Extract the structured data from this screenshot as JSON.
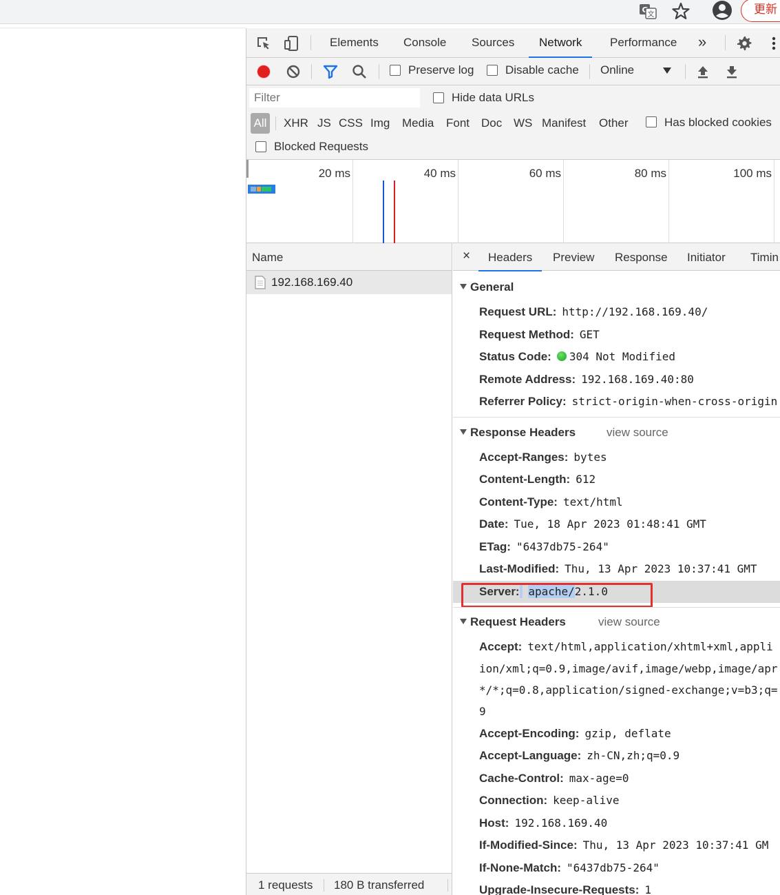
{
  "browser": {
    "update_label": "更新",
    "icons": [
      "translate-icon",
      "star-icon",
      "profile-icon"
    ]
  },
  "devtools": {
    "main_tabs": [
      {
        "label": "Elements",
        "active": false
      },
      {
        "label": "Console",
        "active": false
      },
      {
        "label": "Sources",
        "active": false
      },
      {
        "label": "Network",
        "active": true
      },
      {
        "label": "Performance",
        "active": false
      }
    ],
    "more_tabs": "»",
    "toolbar": {
      "preserve_log": "Preserve log",
      "disable_cache": "Disable cache",
      "throttle": "Online"
    },
    "filter": {
      "placeholder": "Filter",
      "hide_data_urls": "Hide data URLs",
      "types": [
        "All",
        "XHR",
        "JS",
        "CSS",
        "Img",
        "Media",
        "Font",
        "Doc",
        "WS",
        "Manifest",
        "Other"
      ],
      "has_blocked_cookies": "Has blocked cookies",
      "blocked_requests": "Blocked Requests"
    },
    "overview": {
      "ticks": [
        "20 ms",
        "40 ms",
        "60 ms",
        "80 ms",
        "100 ms"
      ]
    },
    "requests": {
      "name_header": "Name",
      "rows": [
        "192.168.169.40"
      ],
      "summary": {
        "requests": "1 requests",
        "transferred": "180 B transferred"
      }
    },
    "detail": {
      "close": "×",
      "tabs": [
        "Headers",
        "Preview",
        "Response",
        "Initiator",
        "Timin"
      ],
      "general": {
        "title": "General",
        "request_url_k": "Request URL:",
        "request_url_v": "http://192.168.169.40/",
        "request_method_k": "Request Method:",
        "request_method_v": "GET",
        "status_code_k": "Status Code:",
        "status_code_v": "304 Not Modified",
        "remote_address_k": "Remote Address:",
        "remote_address_v": "192.168.169.40:80",
        "referrer_policy_k": "Referrer Policy:",
        "referrer_policy_v": "strict-origin-when-cross-origin"
      },
      "response_headers": {
        "title": "Response Headers",
        "view_source": "view source",
        "accept_ranges_k": "Accept-Ranges:",
        "accept_ranges_v": "bytes",
        "content_length_k": "Content-Length:",
        "content_length_v": "612",
        "content_type_k": "Content-Type:",
        "content_type_v": "text/html",
        "date_k": "Date:",
        "date_v": "Tue, 18 Apr 2023 01:48:41 GMT",
        "etag_k": "ETag:",
        "etag_v": "\"6437db75-264\"",
        "last_modified_k": "Last-Modified:",
        "last_modified_v": "Thu, 13 Apr 2023 10:37:41 GMT",
        "server_k": "Server:",
        "server_v_sel": "apache/",
        "server_v_rest": "2.1.0"
      },
      "request_headers": {
        "title": "Request Headers",
        "view_source": "view source",
        "accept_k": "Accept:",
        "accept_v": "text/html,application/xhtml+xml,appli",
        "accept_c1": "ion/xml;q=0.9,image/avif,image/webp,image/apr",
        "accept_c2": "*/*;q=0.8,application/signed-exchange;v=b3;q=",
        "accept_c3": "9",
        "accept_encoding_k": "Accept-Encoding:",
        "accept_encoding_v": "gzip, deflate",
        "accept_language_k": "Accept-Language:",
        "accept_language_v": "zh-CN,zh;q=0.9",
        "cache_control_k": "Cache-Control:",
        "cache_control_v": "max-age=0",
        "connection_k": "Connection:",
        "connection_v": "keep-alive",
        "host_k": "Host:",
        "host_v": "192.168.169.40",
        "if_modified_since_k": "If-Modified-Since:",
        "if_modified_since_v": "Thu, 13 Apr 2023 10:37:41 GM",
        "if_none_match_k": "If-None-Match:",
        "if_none_match_v": "\"6437db75-264\"",
        "upgrade_k": "Upgrade-Insecure-Requests:",
        "upgrade_v": "1"
      }
    }
  }
}
